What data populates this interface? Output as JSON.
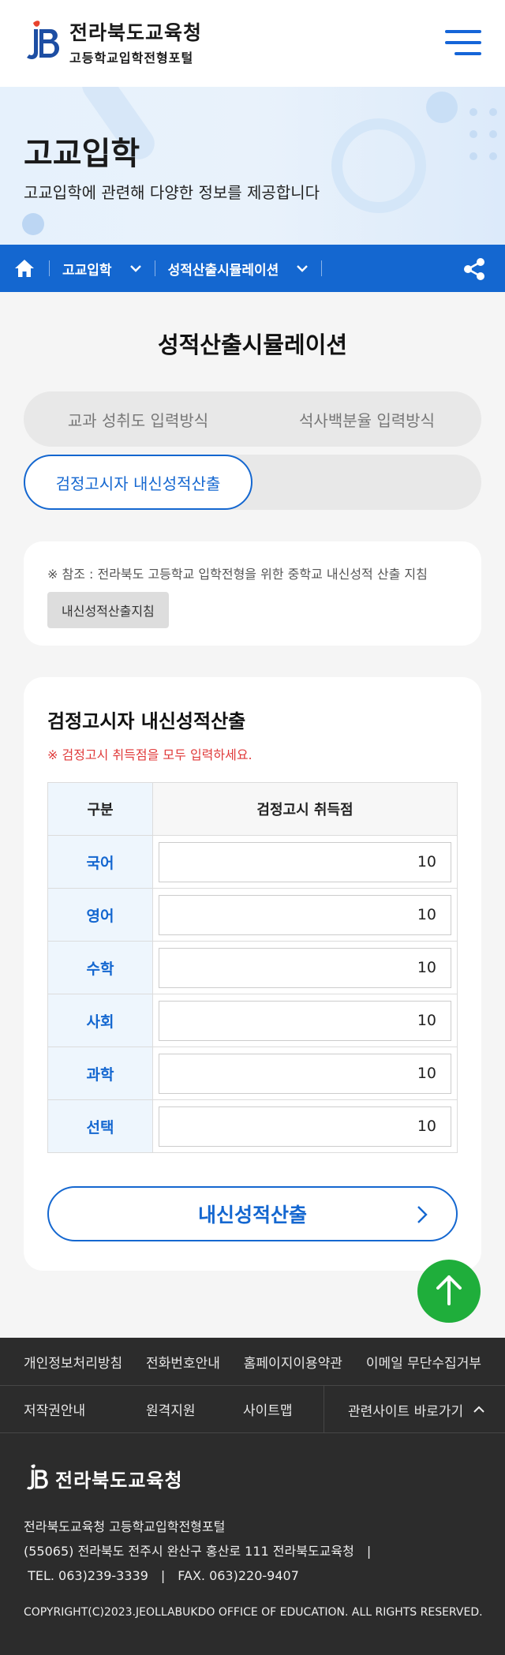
{
  "header": {
    "org_name": "전라북도교육청",
    "portal_name": "고등학교입학전형포털"
  },
  "banner": {
    "title": "고교입학",
    "description": "고교입학에 관련해 다양한 정보를 제공합니다"
  },
  "breadcrumb": {
    "level1": "고교입학",
    "level2": "성적산출시뮬레이션"
  },
  "page_title": "성적산출시뮬레이션",
  "tabs": {
    "tab1": "교과 성취도 입력방식",
    "tab2": "석사백분율 입력방식",
    "tab3": "검정고시자 내신성적산출"
  },
  "note": {
    "text": "※ 참조 : 전라북도 고등학교 입학전형을 위한 중학교 내신성적 산출 지침",
    "button": "내신성적산출지침"
  },
  "calc": {
    "title": "검정고시자 내신성적산출",
    "warning": "※ 검정고시 취득점을 모두 입력하세요.",
    "col_category": "구분",
    "col_score": "검정고시 취득점",
    "rows": [
      {
        "subject": "국어",
        "score": "10"
      },
      {
        "subject": "영어",
        "score": "10"
      },
      {
        "subject": "수학",
        "score": "10"
      },
      {
        "subject": "사회",
        "score": "10"
      },
      {
        "subject": "과학",
        "score": "10"
      },
      {
        "subject": "선택",
        "score": "10"
      }
    ],
    "submit": "내신성적산출"
  },
  "footer": {
    "links1": [
      "개인정보처리방침",
      "전화번호안내",
      "홈페이지이용약관",
      "이메일 무단수집거부"
    ],
    "links2": [
      "저작권안내",
      "원격지원",
      "사이트맵"
    ],
    "related": "관련사이트 바로가기",
    "logo_text": "전라북도교육청",
    "info_line1": "전라북도교육청 고등학교입학전형포털",
    "info_line2": "(55065) 전라북도 전주시 완산구 홍산로 111 전라북도교육청　|",
    "info_line3": " TEL. 063)239-3339　|　FAX. 063)220-9407",
    "copyright": "COPYRIGHT(C)2023.JEOLLABUKDO OFFICE OF EDUCATION. ALL RIGHTS RESERVED."
  },
  "colors": {
    "primary": "#1467d0",
    "accent_red": "#e03a3a",
    "top_button": "#1fae3b",
    "footer_bg": "#2c2c2c"
  },
  "icons": [
    "menu-icon",
    "home-icon",
    "chevron-down-icon",
    "share-icon",
    "chevron-right-icon",
    "arrow-up-icon",
    "chevron-up-icon"
  ]
}
